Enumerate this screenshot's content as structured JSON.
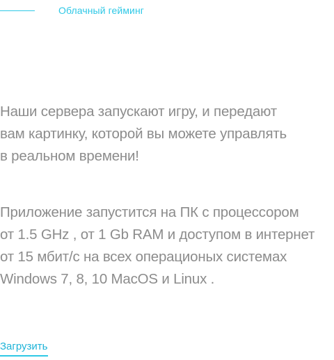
{
  "header": {
    "eyebrow_label": "Облачный гейминг"
  },
  "content": {
    "paragraph_1": "Наши сервера запускают игру, и передают\nвам картинку, которой вы можете управлять\nв реальном времени!",
    "paragraph_2": "Приложение  запустится на ПК с процессором\nот 1.5 GHz , от 1 Gb RAM и доступом в интернет\nот 15 мбит/с  на всех операционых системах\nWindows 7, 8, 10 MacOS и Linux ."
  },
  "actions": {
    "download_label": "Загрузить"
  },
  "colors": {
    "accent": "#2ec8e6",
    "body_text": "#8c8c8c"
  }
}
